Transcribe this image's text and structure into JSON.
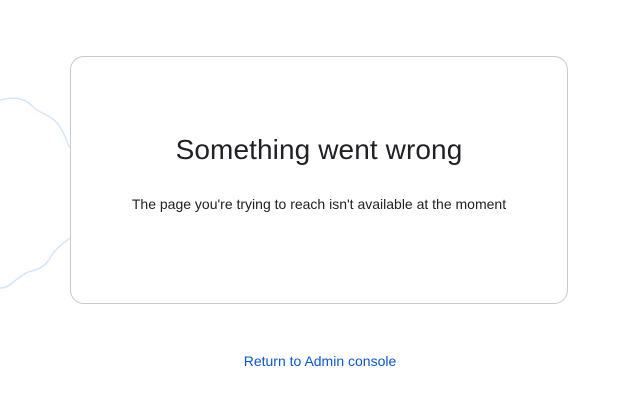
{
  "error": {
    "title": "Something went wrong",
    "message": "The page you're trying to reach isn't available at the moment"
  },
  "actions": {
    "return_label": "Return to Admin console"
  },
  "colors": {
    "link": "#0b57d0",
    "text": "#202124",
    "card_border": "#c6c9cd",
    "decoration": "#d2e3fc"
  },
  "decoration": {
    "icon": "cloud-outline-decoration"
  }
}
